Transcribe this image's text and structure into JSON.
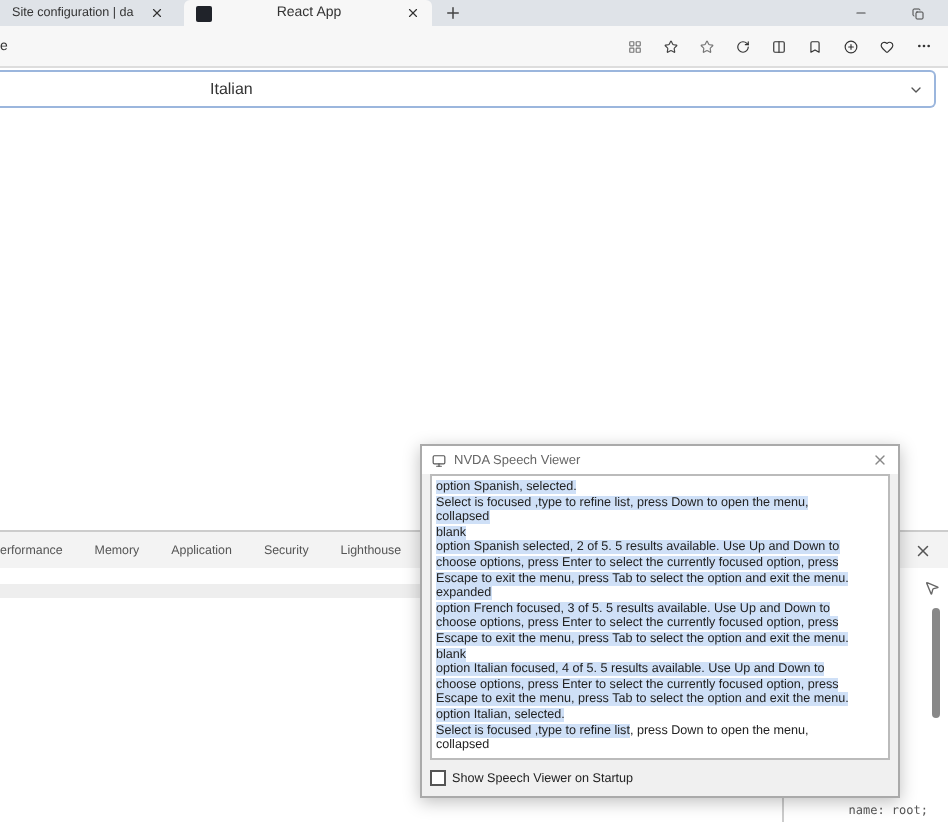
{
  "browser_tabs": [
    {
      "title": "Site configuration | da",
      "selected": false
    },
    {
      "title": "React App",
      "selected": true
    }
  ],
  "address_bar": {
    "url": "e"
  },
  "select": {
    "value": "Italian"
  },
  "devtools": {
    "tabs": [
      {
        "label": "erformance",
        "selected": false
      },
      {
        "label": "Memory",
        "selected": false
      },
      {
        "label": "Application",
        "selected": false
      },
      {
        "label": "Security",
        "selected": false
      },
      {
        "label": "Lighthouse",
        "selected": false
      }
    ],
    "code": "name: root;"
  },
  "speech_viewer": {
    "title": "NVDA Speech Viewer",
    "lines": [
      {
        "segments": [
          {
            "text": "option Spanish, selected.",
            "selected": true
          }
        ]
      },
      {
        "segments": [
          {
            "text": " Select is focused ,type to refine list, press Down to open the menu,",
            "selected": true
          }
        ]
      },
      {
        "segments": [
          {
            "text": "collapsed",
            "selected": true
          }
        ]
      },
      {
        "segments": [
          {
            "text": "blank",
            "selected": true
          }
        ]
      },
      {
        "segments": [
          {
            "text": "option Spanish selected, 2 of 5. 5 results available. Use Up and Down to choose options, press Enter to select the currently focused option, press Escape to exit the menu, press Tab to select the option and exit the menu.",
            "selected": true
          }
        ]
      },
      {
        "segments": [
          {
            "text": "expanded",
            "selected": true
          }
        ]
      },
      {
        "segments": [
          {
            "text": "option French focused, 3 of 5. 5 results available. Use Up and Down to choose options, press Enter to select the currently focused option, press Escape to exit the menu, press Tab to select the option and exit the menu.",
            "selected": true
          }
        ]
      },
      {
        "segments": [
          {
            "text": "blank",
            "selected": true
          }
        ]
      },
      {
        "segments": [
          {
            "text": "option Italian focused, 4 of 5. 5 results available. Use Up and Down to choose options, press Enter to select the currently focused option, press Escape to exit the menu, press Tab to select the option and exit the menu.",
            "selected": true
          }
        ]
      },
      {
        "segments": [
          {
            "text": "option Italian, selected.",
            "selected": true
          }
        ]
      },
      {
        "segments": [
          {
            "text": " Select is focused ,type to refine list",
            "selected": true
          },
          {
            "text": ", press Down to open the menu,",
            "selected": false
          }
        ]
      },
      {
        "segments": [
          {
            "text": "collapsed",
            "selected": false
          }
        ]
      }
    ],
    "checkbox": {
      "label": "Show Speech Viewer on Startup",
      "checked": false
    }
  }
}
